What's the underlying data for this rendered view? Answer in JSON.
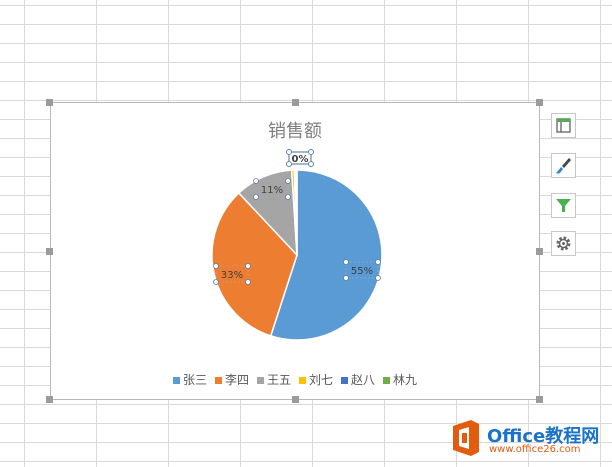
{
  "chart_data": {
    "type": "pie",
    "title": "销售额",
    "categories": [
      "张三",
      "李四",
      "王五",
      "刘七",
      "赵八",
      "林九"
    ],
    "values": [
      55,
      33,
      11,
      0.5,
      0.3,
      0.2
    ],
    "data_labels": [
      "55%",
      "33%",
      "11%",
      "1%",
      "0%",
      "0%"
    ],
    "colors": [
      "#5b9bd5",
      "#ed7d31",
      "#a5a5a5",
      "#ffc000",
      "#4472c4",
      "#70ad47"
    ],
    "legend_position": "bottom"
  },
  "toolbar": {
    "tools": [
      "chart-elements-icon",
      "chart-styles-icon",
      "chart-filters-icon",
      "gear-icon"
    ]
  },
  "watermark": {
    "brand": "Office教程网",
    "url": "www.office26.com"
  }
}
